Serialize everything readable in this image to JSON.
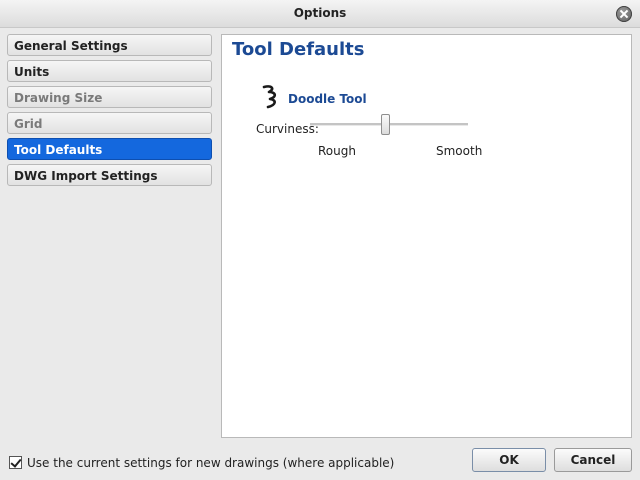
{
  "window": {
    "title": "Options"
  },
  "sidebar": {
    "items": [
      {
        "label": "General Settings",
        "state": "normal"
      },
      {
        "label": "Units",
        "state": "normal"
      },
      {
        "label": "Drawing Size",
        "state": "disabled"
      },
      {
        "label": "Grid",
        "state": "disabled"
      },
      {
        "label": "Tool Defaults",
        "state": "selected"
      },
      {
        "label": "DWG Import Settings",
        "state": "normal"
      }
    ]
  },
  "panel": {
    "title": "Tool Defaults",
    "tool": {
      "name": "Doodle Tool",
      "icon": "doodle-squiggle-icon"
    },
    "curviness": {
      "label": "Curviness:",
      "min_label": "Rough",
      "max_label": "Smooth",
      "value_fraction": 0.5
    }
  },
  "footer": {
    "checkbox_label": "Use the current settings for new drawings (where applicable)",
    "checkbox_checked": true,
    "ok_label": "OK",
    "cancel_label": "Cancel"
  },
  "colors": {
    "selection": "#1468de",
    "heading": "#1c4a94"
  }
}
